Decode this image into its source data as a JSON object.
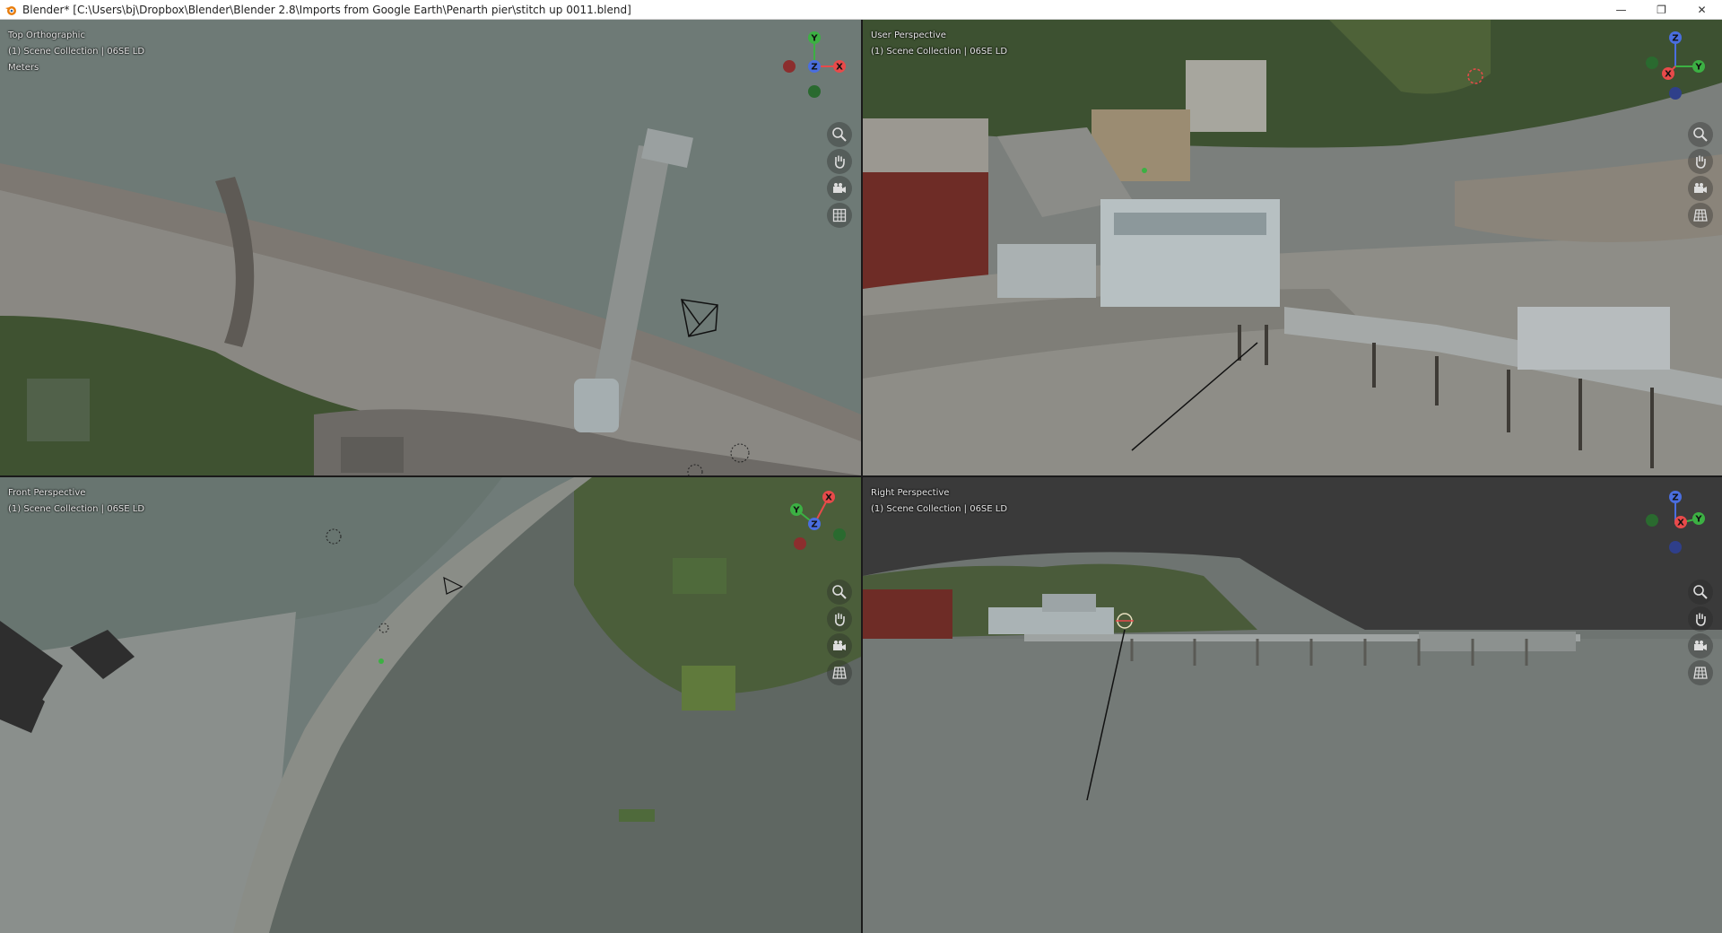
{
  "window": {
    "title": "Blender* [C:\\Users\\bj\\Dropbox\\Blender\\Blender 2.8\\Imports from Google Earth\\Penarth pier\\stitch up 0011.blend]",
    "controls": {
      "minimize": "—",
      "restore": "❐",
      "close": "✕"
    }
  },
  "viewports": [
    {
      "name": "Top Orthographic",
      "collection": "(1) Scene Collection | 06SE LD",
      "units": "Meters"
    },
    {
      "name": "User Perspective",
      "collection": "(1) Scene Collection | 06SE LD"
    },
    {
      "name": "Front Perspective",
      "collection": "(1) Scene Collection | 06SE LD"
    },
    {
      "name": "Right Perspective",
      "collection": "(1) Scene Collection | 06SE LD"
    }
  ],
  "gizmo_axes": {
    "x": "X",
    "y": "Y",
    "z": "Z"
  },
  "nav_icons": [
    "zoom-icon",
    "hand-pan-icon",
    "camera-icon",
    "grid-icon"
  ],
  "colors": {
    "axis_x": "#e84a4a",
    "axis_y": "#3cb043",
    "axis_z": "#4a6ee0",
    "water": "#6f7b78",
    "land": "#4b5e3a"
  }
}
